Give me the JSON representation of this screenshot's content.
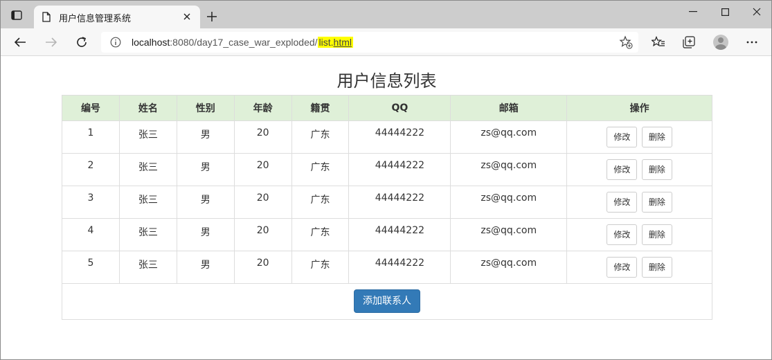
{
  "browser": {
    "tab_title": "用户信息管理系统",
    "url_host": "localhost",
    "url_rest": ":8080/day17_case_war_exploded/",
    "url_highlight_plain": "list.",
    "url_highlight_underline": "html",
    "highlight_color": "#ffff00"
  },
  "page": {
    "title": "用户信息列表",
    "columns": [
      "编号",
      "姓名",
      "性别",
      "年龄",
      "籍贯",
      "QQ",
      "邮箱",
      "操作"
    ],
    "rows": [
      {
        "id": "1",
        "name": "张三",
        "gender": "男",
        "age": "20",
        "origin": "广东",
        "qq": "44444222",
        "email": "zs@qq.com"
      },
      {
        "id": "2",
        "name": "张三",
        "gender": "男",
        "age": "20",
        "origin": "广东",
        "qq": "44444222",
        "email": "zs@qq.com"
      },
      {
        "id": "3",
        "name": "张三",
        "gender": "男",
        "age": "20",
        "origin": "广东",
        "qq": "44444222",
        "email": "zs@qq.com"
      },
      {
        "id": "4",
        "name": "张三",
        "gender": "男",
        "age": "20",
        "origin": "广东",
        "qq": "44444222",
        "email": "zs@qq.com"
      },
      {
        "id": "5",
        "name": "张三",
        "gender": "男",
        "age": "20",
        "origin": "广东",
        "qq": "44444222",
        "email": "zs@qq.com"
      }
    ],
    "edit_label": "修改",
    "delete_label": "删除",
    "add_label": "添加联系人",
    "header_bg": "#dff0d8",
    "primary_color": "#337ab7"
  }
}
